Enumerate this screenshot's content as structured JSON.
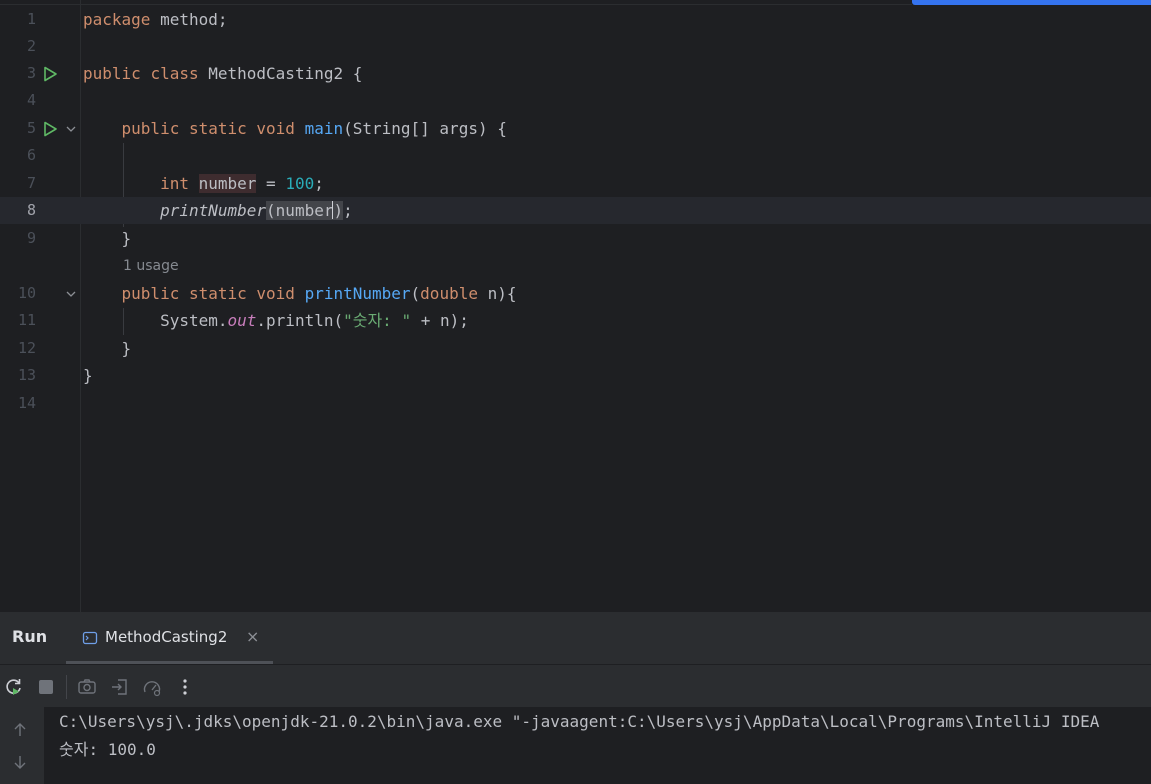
{
  "editor": {
    "line_numbers": [
      "1",
      "2",
      "3",
      "4",
      "5",
      "6",
      "7",
      "8",
      "9",
      "10",
      "11",
      "12",
      "13",
      "14"
    ],
    "code": {
      "l1_kw": "package",
      "l1_rest": " method;",
      "l3_kw1": "public",
      "l3_kw2": "class",
      "l3_rest": " MethodCasting2 {",
      "l5_kw": "public static void",
      "l5_fn": "main",
      "l5_rest": "(String[] args) {",
      "l7_kw": "int",
      "l7_var": "number",
      "l7_eq": " = ",
      "l7_num": "100",
      "l7_semi": ";",
      "l8_fn": "printNumber",
      "l8_open": "(",
      "l8_arg": "number",
      "l8_close": ")",
      "l8_semi": ";",
      "l9": "}",
      "usage_hint": "1 usage",
      "l10_kw": "public static void",
      "l10_fn": "printNumber",
      "l10_open": "(",
      "l10_type": "double",
      "l10_rest": " n){",
      "l11_a": "System.",
      "l11_out": "out",
      "l11_b": ".println(",
      "l11_str": "\"숫자: \"",
      "l11_c": " + n);",
      "l12": "}",
      "l13": "}"
    }
  },
  "run_panel": {
    "title": "Run",
    "tab_label": "MethodCasting2",
    "tab_close": "×",
    "console_lines": [
      "C:\\Users\\ysj\\.jdks\\openjdk-21.0.2\\bin\\java.exe \"-javaagent:C:\\Users\\ysj\\AppData\\Local\\Programs\\IntelliJ IDEA",
      "숫자: 100.0"
    ]
  },
  "icons": {
    "run_gutter": "run-triangle-icon",
    "fold": "chevron-down-icon",
    "rerun": "rerun-icon",
    "stop": "stop-icon",
    "screenshot": "camera-icon",
    "restore": "restore-layout-icon",
    "coverage": "gauge-icon",
    "more": "more-vertical-icon",
    "scroll_up": "arrow-up-icon",
    "scroll_down": "arrow-down-icon"
  },
  "colors": {
    "keyword": "#cf8e6d",
    "function": "#56a8f5",
    "number": "#2aacb8",
    "string": "#6aab73",
    "static_field": "#c77dbb",
    "accent": "#3574f0",
    "run_green": "#5fb865"
  }
}
